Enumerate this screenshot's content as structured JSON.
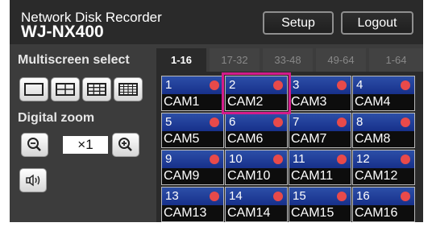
{
  "header": {
    "subtitle": "Network Disk Recorder",
    "title": "WJ-NX400",
    "setup_label": "Setup",
    "logout_label": "Logout"
  },
  "left": {
    "multiscreen_label": "Multiscreen select",
    "digital_zoom_label": "Digital zoom",
    "zoom_value": "×1"
  },
  "tabs": [
    {
      "label": "1-16",
      "active": true
    },
    {
      "label": "17-32",
      "active": false
    },
    {
      "label": "33-48",
      "active": false
    },
    {
      "label": "49-64",
      "active": false
    },
    {
      "label": "1-64",
      "active": false
    }
  ],
  "cameras": [
    {
      "num": "1",
      "name": "CAM1"
    },
    {
      "num": "2",
      "name": "CAM2",
      "highlighted": true
    },
    {
      "num": "3",
      "name": "CAM3"
    },
    {
      "num": "4",
      "name": "CAM4"
    },
    {
      "num": "5",
      "name": "CAM5"
    },
    {
      "num": "6",
      "name": "CAM6"
    },
    {
      "num": "7",
      "name": "CAM7"
    },
    {
      "num": "8",
      "name": "CAM8"
    },
    {
      "num": "9",
      "name": "CAM9"
    },
    {
      "num": "10",
      "name": "CAM10"
    },
    {
      "num": "11",
      "name": "CAM11"
    },
    {
      "num": "12",
      "name": "CAM12"
    },
    {
      "num": "13",
      "name": "CAM13"
    },
    {
      "num": "14",
      "name": "CAM14"
    },
    {
      "num": "15",
      "name": "CAM15"
    },
    {
      "num": "16",
      "name": "CAM16"
    }
  ],
  "colors": {
    "highlight": "#d41c8b",
    "rec_indicator": "#e84a4a",
    "cell_header": "#1f3c9a"
  }
}
